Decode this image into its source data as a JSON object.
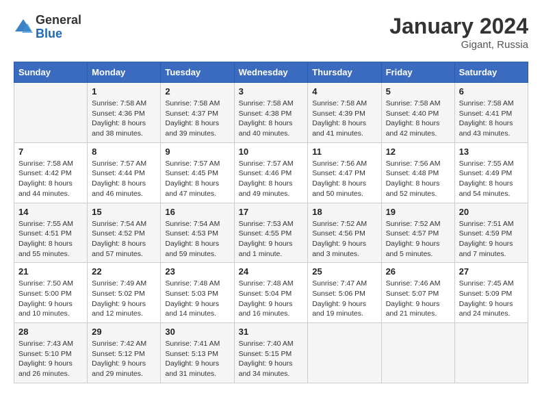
{
  "logo": {
    "general": "General",
    "blue": "Blue"
  },
  "title": "January 2024",
  "location": "Gigant, Russia",
  "days_of_week": [
    "Sunday",
    "Monday",
    "Tuesday",
    "Wednesday",
    "Thursday",
    "Friday",
    "Saturday"
  ],
  "weeks": [
    [
      {
        "day": "",
        "sunrise": "",
        "sunset": "",
        "daylight": ""
      },
      {
        "day": "1",
        "sunrise": "Sunrise: 7:58 AM",
        "sunset": "Sunset: 4:36 PM",
        "daylight": "Daylight: 8 hours and 38 minutes."
      },
      {
        "day": "2",
        "sunrise": "Sunrise: 7:58 AM",
        "sunset": "Sunset: 4:37 PM",
        "daylight": "Daylight: 8 hours and 39 minutes."
      },
      {
        "day": "3",
        "sunrise": "Sunrise: 7:58 AM",
        "sunset": "Sunset: 4:38 PM",
        "daylight": "Daylight: 8 hours and 40 minutes."
      },
      {
        "day": "4",
        "sunrise": "Sunrise: 7:58 AM",
        "sunset": "Sunset: 4:39 PM",
        "daylight": "Daylight: 8 hours and 41 minutes."
      },
      {
        "day": "5",
        "sunrise": "Sunrise: 7:58 AM",
        "sunset": "Sunset: 4:40 PM",
        "daylight": "Daylight: 8 hours and 42 minutes."
      },
      {
        "day": "6",
        "sunrise": "Sunrise: 7:58 AM",
        "sunset": "Sunset: 4:41 PM",
        "daylight": "Daylight: 8 hours and 43 minutes."
      }
    ],
    [
      {
        "day": "7",
        "sunrise": "Sunrise: 7:58 AM",
        "sunset": "Sunset: 4:42 PM",
        "daylight": "Daylight: 8 hours and 44 minutes."
      },
      {
        "day": "8",
        "sunrise": "Sunrise: 7:57 AM",
        "sunset": "Sunset: 4:44 PM",
        "daylight": "Daylight: 8 hours and 46 minutes."
      },
      {
        "day": "9",
        "sunrise": "Sunrise: 7:57 AM",
        "sunset": "Sunset: 4:45 PM",
        "daylight": "Daylight: 8 hours and 47 minutes."
      },
      {
        "day": "10",
        "sunrise": "Sunrise: 7:57 AM",
        "sunset": "Sunset: 4:46 PM",
        "daylight": "Daylight: 8 hours and 49 minutes."
      },
      {
        "day": "11",
        "sunrise": "Sunrise: 7:56 AM",
        "sunset": "Sunset: 4:47 PM",
        "daylight": "Daylight: 8 hours and 50 minutes."
      },
      {
        "day": "12",
        "sunrise": "Sunrise: 7:56 AM",
        "sunset": "Sunset: 4:48 PM",
        "daylight": "Daylight: 8 hours and 52 minutes."
      },
      {
        "day": "13",
        "sunrise": "Sunrise: 7:55 AM",
        "sunset": "Sunset: 4:49 PM",
        "daylight": "Daylight: 8 hours and 54 minutes."
      }
    ],
    [
      {
        "day": "14",
        "sunrise": "Sunrise: 7:55 AM",
        "sunset": "Sunset: 4:51 PM",
        "daylight": "Daylight: 8 hours and 55 minutes."
      },
      {
        "day": "15",
        "sunrise": "Sunrise: 7:54 AM",
        "sunset": "Sunset: 4:52 PM",
        "daylight": "Daylight: 8 hours and 57 minutes."
      },
      {
        "day": "16",
        "sunrise": "Sunrise: 7:54 AM",
        "sunset": "Sunset: 4:53 PM",
        "daylight": "Daylight: 8 hours and 59 minutes."
      },
      {
        "day": "17",
        "sunrise": "Sunrise: 7:53 AM",
        "sunset": "Sunset: 4:55 PM",
        "daylight": "Daylight: 9 hours and 1 minute."
      },
      {
        "day": "18",
        "sunrise": "Sunrise: 7:52 AM",
        "sunset": "Sunset: 4:56 PM",
        "daylight": "Daylight: 9 hours and 3 minutes."
      },
      {
        "day": "19",
        "sunrise": "Sunrise: 7:52 AM",
        "sunset": "Sunset: 4:57 PM",
        "daylight": "Daylight: 9 hours and 5 minutes."
      },
      {
        "day": "20",
        "sunrise": "Sunrise: 7:51 AM",
        "sunset": "Sunset: 4:59 PM",
        "daylight": "Daylight: 9 hours and 7 minutes."
      }
    ],
    [
      {
        "day": "21",
        "sunrise": "Sunrise: 7:50 AM",
        "sunset": "Sunset: 5:00 PM",
        "daylight": "Daylight: 9 hours and 10 minutes."
      },
      {
        "day": "22",
        "sunrise": "Sunrise: 7:49 AM",
        "sunset": "Sunset: 5:02 PM",
        "daylight": "Daylight: 9 hours and 12 minutes."
      },
      {
        "day": "23",
        "sunrise": "Sunrise: 7:48 AM",
        "sunset": "Sunset: 5:03 PM",
        "daylight": "Daylight: 9 hours and 14 minutes."
      },
      {
        "day": "24",
        "sunrise": "Sunrise: 7:48 AM",
        "sunset": "Sunset: 5:04 PM",
        "daylight": "Daylight: 9 hours and 16 minutes."
      },
      {
        "day": "25",
        "sunrise": "Sunrise: 7:47 AM",
        "sunset": "Sunset: 5:06 PM",
        "daylight": "Daylight: 9 hours and 19 minutes."
      },
      {
        "day": "26",
        "sunrise": "Sunrise: 7:46 AM",
        "sunset": "Sunset: 5:07 PM",
        "daylight": "Daylight: 9 hours and 21 minutes."
      },
      {
        "day": "27",
        "sunrise": "Sunrise: 7:45 AM",
        "sunset": "Sunset: 5:09 PM",
        "daylight": "Daylight: 9 hours and 24 minutes."
      }
    ],
    [
      {
        "day": "28",
        "sunrise": "Sunrise: 7:43 AM",
        "sunset": "Sunset: 5:10 PM",
        "daylight": "Daylight: 9 hours and 26 minutes."
      },
      {
        "day": "29",
        "sunrise": "Sunrise: 7:42 AM",
        "sunset": "Sunset: 5:12 PM",
        "daylight": "Daylight: 9 hours and 29 minutes."
      },
      {
        "day": "30",
        "sunrise": "Sunrise: 7:41 AM",
        "sunset": "Sunset: 5:13 PM",
        "daylight": "Daylight: 9 hours and 31 minutes."
      },
      {
        "day": "31",
        "sunrise": "Sunrise: 7:40 AM",
        "sunset": "Sunset: 5:15 PM",
        "daylight": "Daylight: 9 hours and 34 minutes."
      },
      {
        "day": "",
        "sunrise": "",
        "sunset": "",
        "daylight": ""
      },
      {
        "day": "",
        "sunrise": "",
        "sunset": "",
        "daylight": ""
      },
      {
        "day": "",
        "sunrise": "",
        "sunset": "",
        "daylight": ""
      }
    ]
  ]
}
